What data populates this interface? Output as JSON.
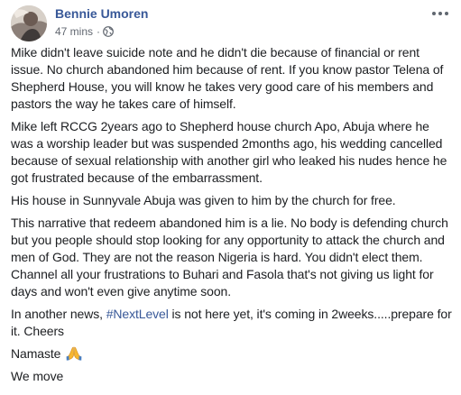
{
  "post": {
    "author": "Bennie Umoren",
    "time": "47 mins",
    "separator": "·",
    "privacy_icon": "globe-icon",
    "more_icon": "more-options-icon",
    "paragraphs": [
      "Mike didn't leave suicide note and he didn't die because of financial or rent issue. No church abandoned him because of rent. If you know pastor Telena of Shepherd House, you will know he takes very good care of his members and pastors the way he takes care of himself.",
      "Mike left RCCG 2years ago to Shepherd house church Apo, Abuja where he was a worship leader but was suspended 2months ago, his wedding cancelled because of sexual relationship with another girl who leaked his nudes hence he got frustrated because of the embarrassment.",
      "His house in Sunnyvale Abuja was given to him by the church for free.",
      "This narrative that redeem abandoned him is a lie. No body is defending church but you people should stop looking for any opportunity to attack the church and men of God. They are not the reason Nigeria is hard. You didn't elect them. Channel all your frustrations to Buhari and Fasola that's not giving us light for days and won't even give anytime soon."
    ],
    "news_prefix": "In another news, ",
    "hashtag": "#NextLevel",
    "news_suffix": " is not here yet, it's coming in 2weeks.....prepare for it. Cheers",
    "namaste": "Namaste",
    "namaste_emoji": "praying-hands-icon",
    "closing": "We move"
  },
  "colors": {
    "link": "#385898",
    "text": "#1c1e21",
    "meta": "#616770"
  }
}
